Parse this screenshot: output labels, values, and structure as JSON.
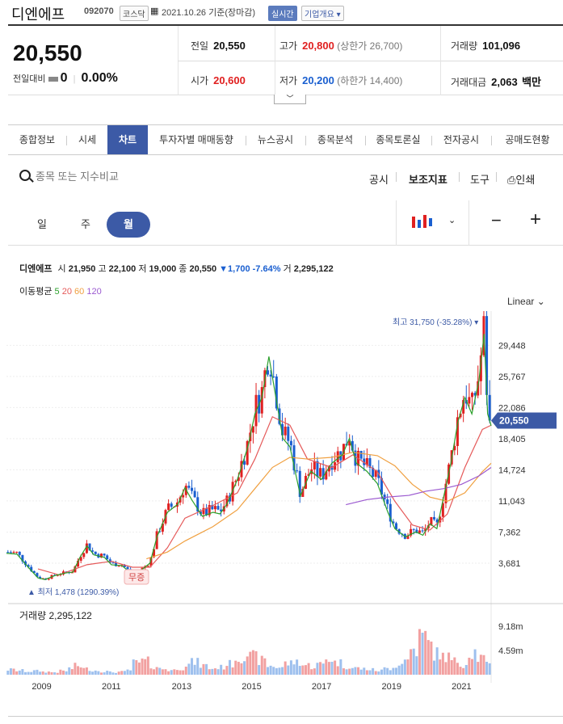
{
  "header": {
    "name": "디엔에프",
    "code": "092070",
    "market": "코스닥",
    "date_basis": "2021.10.26 기준(장마감)",
    "realtime": "실시간",
    "company_info": "기업개요"
  },
  "quote": {
    "price": "20,550",
    "change_label": "전일대비",
    "change_value": "0",
    "change_pct": "0.00%",
    "prev_label": "전일",
    "prev": "20,550",
    "high_label": "고가",
    "high": "20,800",
    "upper_label": "(상한가",
    "upper": "26,700)",
    "volume_label": "거래량",
    "volume": "101,096",
    "open_label": "시가",
    "open": "20,600",
    "low_label": "저가",
    "low": "20,200",
    "lower_label": "(하한가",
    "lower": "14,400)",
    "amount_label": "거래대금",
    "amount": "2,063",
    "amount_unit": "백만"
  },
  "tabs": [
    "종합정보",
    "시세",
    "차트",
    "투자자별 매매동향",
    "뉴스공시",
    "종목분석",
    "종목토론실",
    "전자공시",
    "공매도현황"
  ],
  "toolbar": {
    "search_placeholder": "종목 또는 지수비교",
    "disclosure": "공시",
    "indicators": "보조지표",
    "tools": "도구",
    "print": "인쇄"
  },
  "periods": [
    "일",
    "주",
    "월"
  ],
  "colors": {
    "accent": "#3c5aa6",
    "up": "#e02020",
    "down": "#1a5fd0",
    "ma5": "#2ca02c",
    "ma20": "#e55a5a",
    "ma60": "#f0a040",
    "ma120": "#9b59d0"
  },
  "legend": {
    "name": "디엔에프",
    "open_label": "시",
    "open": "21,950",
    "high_label": "고",
    "high": "22,100",
    "low_label": "저",
    "low": "19,000",
    "close_label": "종",
    "close": "20,550",
    "change": "▼1,700 -7.64%",
    "volume_label": "거",
    "volume": "2,295,122",
    "ma_label": "이동평균",
    "ma5": "5",
    "ma20": "20",
    "ma60": "60",
    "ma120": "120"
  },
  "scale_mode": "Linear",
  "chart_data": {
    "type": "candlestick",
    "y_ticks": [
      3681,
      7362,
      11043,
      14724,
      18405,
      22086,
      25767,
      29448
    ],
    "y_tick_labels": [
      "3,681",
      "7,362",
      "11,043",
      "14,724",
      "18,405",
      "22,086",
      "25,767",
      "29,448"
    ],
    "ylim": [
      1000,
      33500
    ],
    "x_ticks": [
      "2009",
      "2011",
      "2013",
      "2015",
      "2017",
      "2019",
      "2021"
    ],
    "x_range": [
      2008.0,
      2021.85
    ],
    "current_price_label": "20,550",
    "max_annotation": "최고 31,750 (-35.28%)",
    "min_annotation": "최저 1,478 (1290.39%)",
    "event_label": "무증",
    "close_series": [
      [
        2008.0,
        5000
      ],
      [
        2008.3,
        4900
      ],
      [
        2008.6,
        3400
      ],
      [
        2008.9,
        2000
      ],
      [
        2009.1,
        1800
      ],
      [
        2009.4,
        2300
      ],
      [
        2009.7,
        2600
      ],
      [
        2009.9,
        2700
      ],
      [
        2010.1,
        4500
      ],
      [
        2010.3,
        5900
      ],
      [
        2010.5,
        4800
      ],
      [
        2010.8,
        4500
      ],
      [
        2011.0,
        3600
      ],
      [
        2011.3,
        3500
      ],
      [
        2011.6,
        2400
      ],
      [
        2011.9,
        3100
      ],
      [
        2012.1,
        3800
      ],
      [
        2012.3,
        7000
      ],
      [
        2012.6,
        10000
      ],
      [
        2012.9,
        11000
      ],
      [
        2013.1,
        13000
      ],
      [
        2013.3,
        11500
      ],
      [
        2013.6,
        9500
      ],
      [
        2013.9,
        10000
      ],
      [
        2014.1,
        9800
      ],
      [
        2014.3,
        11000
      ],
      [
        2014.6,
        14000
      ],
      [
        2014.9,
        18000
      ],
      [
        2015.1,
        22000
      ],
      [
        2015.3,
        24000
      ],
      [
        2015.5,
        29000
      ],
      [
        2015.7,
        24000
      ],
      [
        2015.9,
        19000
      ],
      [
        2016.1,
        18000
      ],
      [
        2016.4,
        12000
      ],
      [
        2016.7,
        15000
      ],
      [
        2017.0,
        14000
      ],
      [
        2017.3,
        16000
      ],
      [
        2017.6,
        17000
      ],
      [
        2017.8,
        19000
      ],
      [
        2018.0,
        16000
      ],
      [
        2018.3,
        15000
      ],
      [
        2018.6,
        13500
      ],
      [
        2018.9,
        10000
      ],
      [
        2019.1,
        8000
      ],
      [
        2019.4,
        7000
      ],
      [
        2019.7,
        7600
      ],
      [
        2019.9,
        7200
      ],
      [
        2020.1,
        8600
      ],
      [
        2020.3,
        8000
      ],
      [
        2020.5,
        12000
      ],
      [
        2020.7,
        16000
      ],
      [
        2020.9,
        21000
      ],
      [
        2021.1,
        24000
      ],
      [
        2021.3,
        22000
      ],
      [
        2021.5,
        26000
      ],
      [
        2021.65,
        31750
      ],
      [
        2021.75,
        22000
      ],
      [
        2021.85,
        20550
      ]
    ],
    "ma20": [
      [
        2008.9,
        3000
      ],
      [
        2009.5,
        2300
      ],
      [
        2010.3,
        3500
      ],
      [
        2011.0,
        3900
      ],
      [
        2011.6,
        3200
      ],
      [
        2012.1,
        3200
      ],
      [
        2012.6,
        5500
      ],
      [
        2013.1,
        9000
      ],
      [
        2013.9,
        10500
      ],
      [
        2014.6,
        12000
      ],
      [
        2015.1,
        16000
      ],
      [
        2015.6,
        21000
      ],
      [
        2016.1,
        20000
      ],
      [
        2016.6,
        16000
      ],
      [
        2017.3,
        15000
      ],
      [
        2017.9,
        16500
      ],
      [
        2018.6,
        14500
      ],
      [
        2019.1,
        11000
      ],
      [
        2019.6,
        8200
      ],
      [
        2020.1,
        7600
      ],
      [
        2020.6,
        9500
      ],
      [
        2021.1,
        15000
      ],
      [
        2021.6,
        19500
      ],
      [
        2021.85,
        20000
      ]
    ],
    "ma60": [
      [
        2012.0,
        4200
      ],
      [
        2012.6,
        5000
      ],
      [
        2013.1,
        6300
      ],
      [
        2013.9,
        8000
      ],
      [
        2014.6,
        10000
      ],
      [
        2015.1,
        12500
      ],
      [
        2015.6,
        15000
      ],
      [
        2016.1,
        16200
      ],
      [
        2016.6,
        16000
      ],
      [
        2017.3,
        16200
      ],
      [
        2017.9,
        16800
      ],
      [
        2018.6,
        16400
      ],
      [
        2019.1,
        15200
      ],
      [
        2019.6,
        13000
      ],
      [
        2020.1,
        11500
      ],
      [
        2020.6,
        11000
      ],
      [
        2021.1,
        12000
      ],
      [
        2021.6,
        14500
      ],
      [
        2021.85,
        15500
      ]
    ],
    "ma120": [
      [
        2017.7,
        10600
      ],
      [
        2018.3,
        11200
      ],
      [
        2018.9,
        11500
      ],
      [
        2019.5,
        11700
      ],
      [
        2020.0,
        12200
      ],
      [
        2020.5,
        12500
      ],
      [
        2021.0,
        13000
      ],
      [
        2021.5,
        14000
      ],
      [
        2021.85,
        15000
      ]
    ],
    "volume_label": "거래량",
    "volume_value": "2,295,122",
    "volume_ticks": [
      "9.18m",
      "4.59m"
    ],
    "volume_tick_values": [
      9.18,
      4.59
    ],
    "volume_series_m": [
      1.2,
      1.0,
      0.8,
      0.9,
      0.7,
      0.6,
      0.9,
      1.5,
      2.1,
      1.4,
      1.0,
      0.8,
      0.6,
      0.7,
      1.1,
      2.8,
      3.2,
      2.0,
      1.4,
      1.1,
      1.6,
      2.4,
      3.0,
      2.2,
      1.5,
      1.8,
      2.6,
      3.9,
      5.1,
      4.3,
      3.4,
      2.1,
      1.8,
      2.7,
      3.1,
      2.3,
      1.9,
      2.5,
      3.8,
      2.9,
      2.0,
      1.6,
      1.4,
      1.2,
      1.0,
      1.5,
      2.2,
      3.4,
      6.1,
      9.0,
      7.2,
      5.0,
      4.3,
      3.2,
      2.5,
      5.5,
      4.0,
      2.3
    ]
  }
}
